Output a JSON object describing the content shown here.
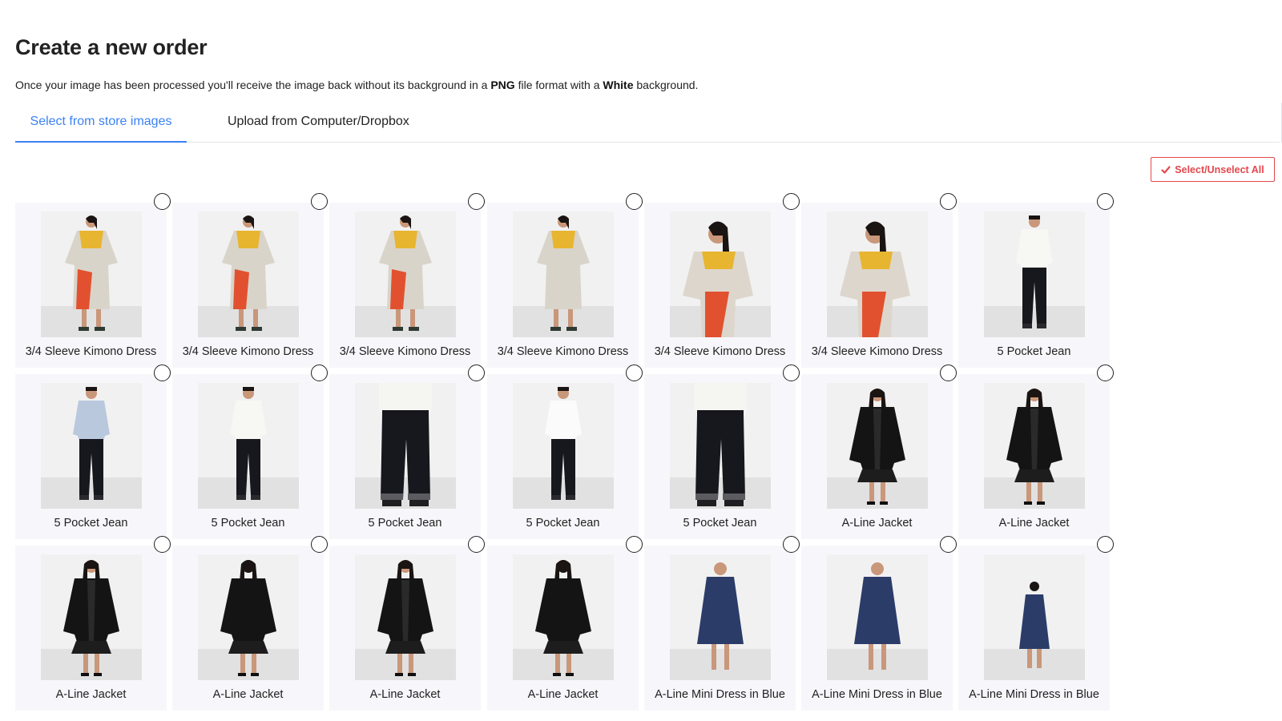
{
  "page": {
    "title": "Create a new order",
    "description": {
      "part1": "Once your image has been processed you'll receive the image back without its background in a ",
      "format": "PNG",
      "part2": " file format with a ",
      "background": "White",
      "part3": " background."
    }
  },
  "tabs": [
    {
      "label": "Select from store images",
      "active": true
    },
    {
      "label": "Upload from Computer/Dropbox",
      "active": false
    }
  ],
  "select_all": {
    "label": "Select/Unselect All",
    "icon": "check-icon"
  },
  "colors": {
    "accent_blue": "#3b82f6",
    "accent_red": "#e4474d",
    "card_bg": "#f7f7fb"
  },
  "products": [
    {
      "name": "3/4 Sleeve Kimono Dress",
      "figure": "kimono",
      "selected": false
    },
    {
      "name": "3/4 Sleeve Kimono Dress",
      "figure": "kimono",
      "selected": false
    },
    {
      "name": "3/4 Sleeve Kimono Dress",
      "figure": "kimono",
      "selected": false
    },
    {
      "name": "3/4 Sleeve Kimono Dress",
      "figure": "kimono-back",
      "selected": false
    },
    {
      "name": "3/4 Sleeve Kimono Dress",
      "figure": "kimono-close",
      "selected": false
    },
    {
      "name": "3/4 Sleeve Kimono Dress",
      "figure": "kimono-close",
      "selected": false
    },
    {
      "name": "5 Pocket Jean",
      "figure": "jean-white",
      "selected": false
    },
    {
      "name": "5 Pocket Jean",
      "figure": "jean-blue",
      "selected": false
    },
    {
      "name": "5 Pocket Jean",
      "figure": "jean-white",
      "selected": false
    },
    {
      "name": "5 Pocket Jean",
      "figure": "jean-close",
      "selected": false
    },
    {
      "name": "5 Pocket Jean",
      "figure": "jean-back",
      "selected": false
    },
    {
      "name": "5 Pocket Jean",
      "figure": "jean-close",
      "selected": false
    },
    {
      "name": "A-Line Jacket",
      "figure": "jacket",
      "selected": false
    },
    {
      "name": "A-Line Jacket",
      "figure": "jacket",
      "selected": false
    },
    {
      "name": "A-Line Jacket",
      "figure": "jacket",
      "selected": false
    },
    {
      "name": "A-Line Jacket",
      "figure": "jacket-back",
      "selected": false
    },
    {
      "name": "A-Line Jacket",
      "figure": "jacket",
      "selected": false
    },
    {
      "name": "A-Line Jacket",
      "figure": "jacket-back",
      "selected": false
    },
    {
      "name": "A-Line Mini Dress in Blue",
      "figure": "blue-dress",
      "selected": false
    },
    {
      "name": "A-Line Mini Dress in Blue",
      "figure": "blue-dress",
      "selected": false
    },
    {
      "name": "A-Line Mini Dress in Blue",
      "figure": "blue-dress-back",
      "selected": false
    }
  ]
}
